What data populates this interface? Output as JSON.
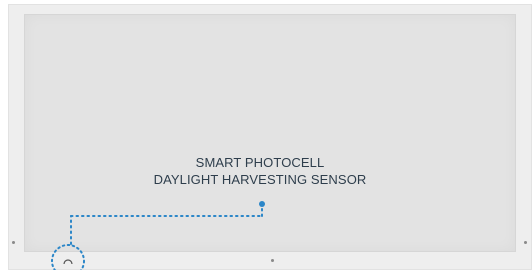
{
  "callout": {
    "line1": "SMART PHOTOCELL",
    "line2": "DAYLIGHT HARVESTING SENSOR"
  },
  "colors": {
    "accent": "#2b86c8",
    "text": "#2e3e4c",
    "frame": "#eeeeee",
    "face": "#e3e3e3"
  }
}
